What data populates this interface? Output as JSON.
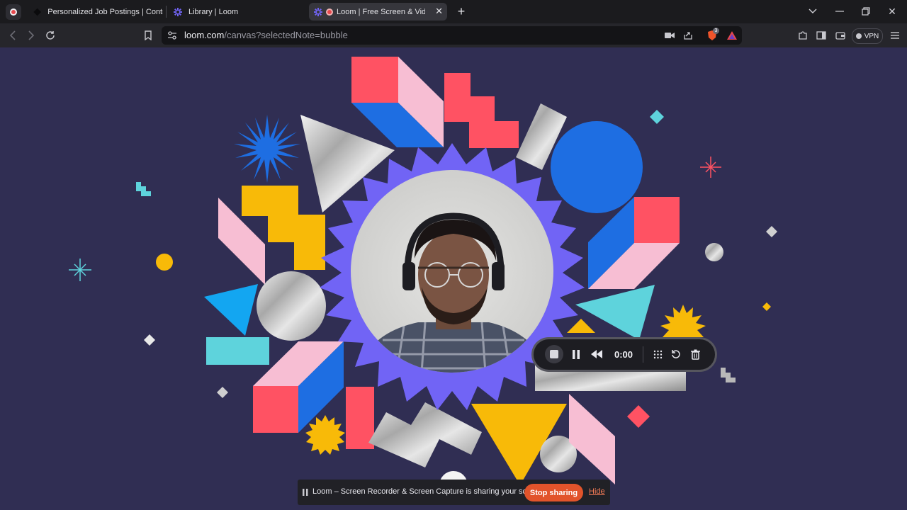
{
  "browser": {
    "tabs": [
      {
        "title": "Personalized Job Postings | Contra",
        "active": false
      },
      {
        "title": "Library | Loom",
        "active": false
      },
      {
        "title": "Loom | Free Screen & Video Recording",
        "active": true
      }
    ],
    "address": {
      "domain": "loom.com",
      "path": "/canvas?selectedNote=bubble"
    },
    "shields_badge": "3",
    "vpn_label": "VPN"
  },
  "recorder": {
    "timer": "0:00"
  },
  "share_banner": {
    "message": "Loom – Screen Recorder & Screen Capture is sharing your screen.",
    "stop_label": "Stop sharing",
    "hide_label": "Hide"
  },
  "colors": {
    "canvas_bg": "#302e53",
    "stop_button": "#e2542b",
    "accent_purple": "#7164f5"
  },
  "icons": [
    "record-dot-icon",
    "contra-icon",
    "loom-icon",
    "close-icon",
    "new-tab-icon",
    "minimize-icon",
    "restore-icon",
    "window-close-icon",
    "back-icon",
    "forward-icon",
    "reload-icon",
    "bookmark-icon",
    "site-settings-icon",
    "camera-icon",
    "share-icon",
    "brave-shields-icon",
    "brave-rewards-icon",
    "extensions-icon",
    "sidebar-icon",
    "wallet-icon",
    "menu-icon",
    "stop-icon",
    "pause-icon",
    "rewind-icon",
    "grid-icon",
    "restart-icon",
    "trash-icon",
    "sharing-pause-icon"
  ]
}
